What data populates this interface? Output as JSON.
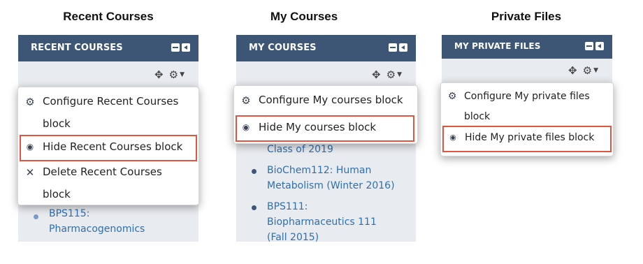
{
  "recent": {
    "panel_title": "Recent Courses",
    "header": "RECENT COURSES",
    "menu": [
      {
        "icon": "gear-icon",
        "label_l1": "Configure Recent Courses",
        "label_l2": "block",
        "highlighted": false
      },
      {
        "icon": "eye-icon",
        "label_l1": "Hide Recent Courses block",
        "label_l2": "",
        "highlighted": true
      },
      {
        "icon": "close-icon",
        "label_l1": "Delete Recent Courses",
        "label_l2": "block",
        "highlighted": false
      }
    ],
    "items": [
      {
        "l1": "BPS115:",
        "l2": "Pharmacogenomics"
      }
    ]
  },
  "my": {
    "panel_title": "My Courses",
    "header": "MY COURSES",
    "menu": [
      {
        "icon": "gear-icon",
        "label_l1": "Configure My courses block",
        "label_l2": "",
        "highlighted": false
      },
      {
        "icon": "eye-icon",
        "label_l1": "Hide My courses block",
        "label_l2": "",
        "highlighted": true
      }
    ],
    "items": [
      {
        "l1": "Class of 2019",
        "l2": ""
      },
      {
        "l1": "BioChem112: Human",
        "l2": "Metabolism (Winter 2016)"
      },
      {
        "l1": "BPS111:",
        "l2": "Biopharmaceutics 111",
        "l3": "(Fall 2015)"
      }
    ]
  },
  "files": {
    "panel_title": "Private Files",
    "header": "MY PRIVATE FILES",
    "menu": [
      {
        "icon": "gear-icon",
        "label_l1": "Configure My private files",
        "label_l2": "block",
        "highlighted": false
      },
      {
        "icon": "eye-icon",
        "label_l1": "Hide My private files block",
        "label_l2": "",
        "highlighted": true
      }
    ]
  },
  "icons": {
    "move": "✥",
    "gear": "⚙",
    "caret": "▼",
    "close": "✕",
    "eye": "◉"
  },
  "colors": {
    "header_bg": "#3e5676",
    "highlight_border": "#e0553f",
    "link": "#2f6fb0",
    "block_bg": "#e8ebef"
  }
}
